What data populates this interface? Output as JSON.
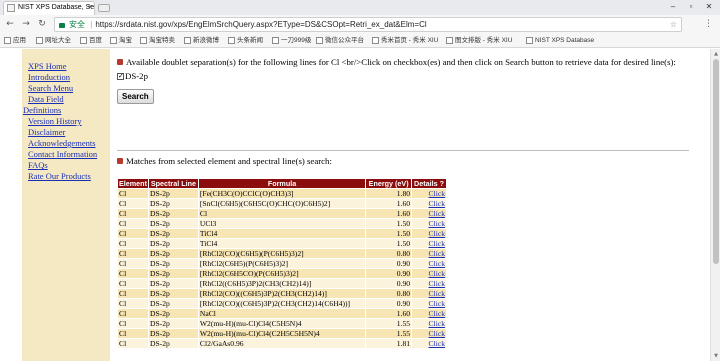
{
  "browser": {
    "tab_title": "NIST XPS Database, Se",
    "tab_close": "×",
    "url_secure_label": "安全",
    "url": "https://srdata.nist.gov/xps/EngElmSrchQuery.aspx?EType=DS&CSOpt=Retri_ex_dat&Elm=Cl",
    "icons": [
      "back-icon",
      "forward-icon",
      "reload-icon",
      "lock-icon",
      "star-icon",
      "menu-icon"
    ],
    "bookmarks": [
      {
        "label": "应用"
      },
      {
        "label": "网址大全"
      },
      {
        "label": "百度"
      },
      {
        "label": "淘宝"
      },
      {
        "label": "淘宝特卖"
      },
      {
        "label": "新浪微博"
      },
      {
        "label": "头条新闻"
      },
      {
        "label": "一刀999级"
      },
      {
        "label": "微信公众平台"
      },
      {
        "label": "秀米首页 - 秀米 XIU"
      },
      {
        "label": "图文排版 - 秀米 XIU"
      },
      {
        "label": "NIST XPS Database"
      }
    ]
  },
  "sidebar": {
    "items": [
      {
        "label": "XPS Home"
      },
      {
        "label": "Introduction"
      },
      {
        "label": "Search Menu"
      },
      {
        "label": "Data Field"
      },
      {
        "label": "Definitions"
      },
      {
        "label": "Version History"
      },
      {
        "label": "Disclaimer"
      },
      {
        "label": "Acknowledgements"
      },
      {
        "label": "Contact Information"
      },
      {
        "label": "FAQs"
      },
      {
        "label": "Rate Our Products"
      }
    ]
  },
  "main": {
    "prompt": "Available doublet separation(s) for the following lines for Cl <br/>Click on checkbox(es) and then click on Search button to retrieve data for desired line(s):",
    "checkbox_label": "DS-2p",
    "search_button": "Search",
    "matches_text": "Matches from selected element and spectral line(s) search:",
    "table": {
      "headers": [
        "Element",
        "Spectral Line",
        "Formula",
        "Energy (eV)",
        "Details ?"
      ],
      "rows": [
        [
          "Cl",
          "DS-2p",
          "[Fe(CH3C(O)CClC(O)CH3)3]",
          "1.80",
          "Click"
        ],
        [
          "Cl",
          "DS-2p",
          "[SnCl(C6H5)(C6H5C(O)CHC(O)C6H5)2]",
          "1.60",
          "Click"
        ],
        [
          "Cl",
          "DS-2p",
          "Cl",
          "1.60",
          "Click"
        ],
        [
          "Cl",
          "DS-2p",
          "UCl3",
          "1.50",
          "Click"
        ],
        [
          "Cl",
          "DS-2p",
          "TiCl4",
          "1.50",
          "Click"
        ],
        [
          "Cl",
          "DS-2p",
          "TiCl4",
          "1.50",
          "Click"
        ],
        [
          "Cl",
          "DS-2p",
          "[RhCl2(CO)(C6H5)(P(C6H5)3)2]",
          "0.80",
          "Click"
        ],
        [
          "Cl",
          "DS-2p",
          "[RhCl2(C6H5)(P(C6H5)3)2]",
          "0.90",
          "Click"
        ],
        [
          "Cl",
          "DS-2p",
          "[RhCl2(C6H5CO)(P(C6H5)3)2]",
          "0.90",
          "Click"
        ],
        [
          "Cl",
          "DS-2p",
          "[RhCl2((C6H5)3P)2(CH3(CH2)14)]",
          "0.90",
          "Click"
        ],
        [
          "Cl",
          "DS-2p",
          "[RhCl2(CO)((C6H5)3P)2(CH3(CH2)14)]",
          "0.80",
          "Click"
        ],
        [
          "Cl",
          "DS-2p",
          "[RhCl2(CO)((C6H5)3P)2(CH3(CH2)14(C6H4))]",
          "0.90",
          "Click"
        ],
        [
          "Cl",
          "DS-2p",
          "NaCl",
          "1.60",
          "Click"
        ],
        [
          "Cl",
          "DS-2p",
          "W2(mu-H)(mu-Cl)Cl4(C5H5N)4",
          "1.55",
          "Click"
        ],
        [
          "Cl",
          "DS-2p",
          "W2(mu-H)(mu-Cl)Cl4(C2H5C5H5N)4",
          "1.55",
          "Click"
        ],
        [
          "Cl",
          "DS-2p",
          "Cl2/GaAs0.96",
          "1.81",
          "Click"
        ]
      ]
    }
  }
}
